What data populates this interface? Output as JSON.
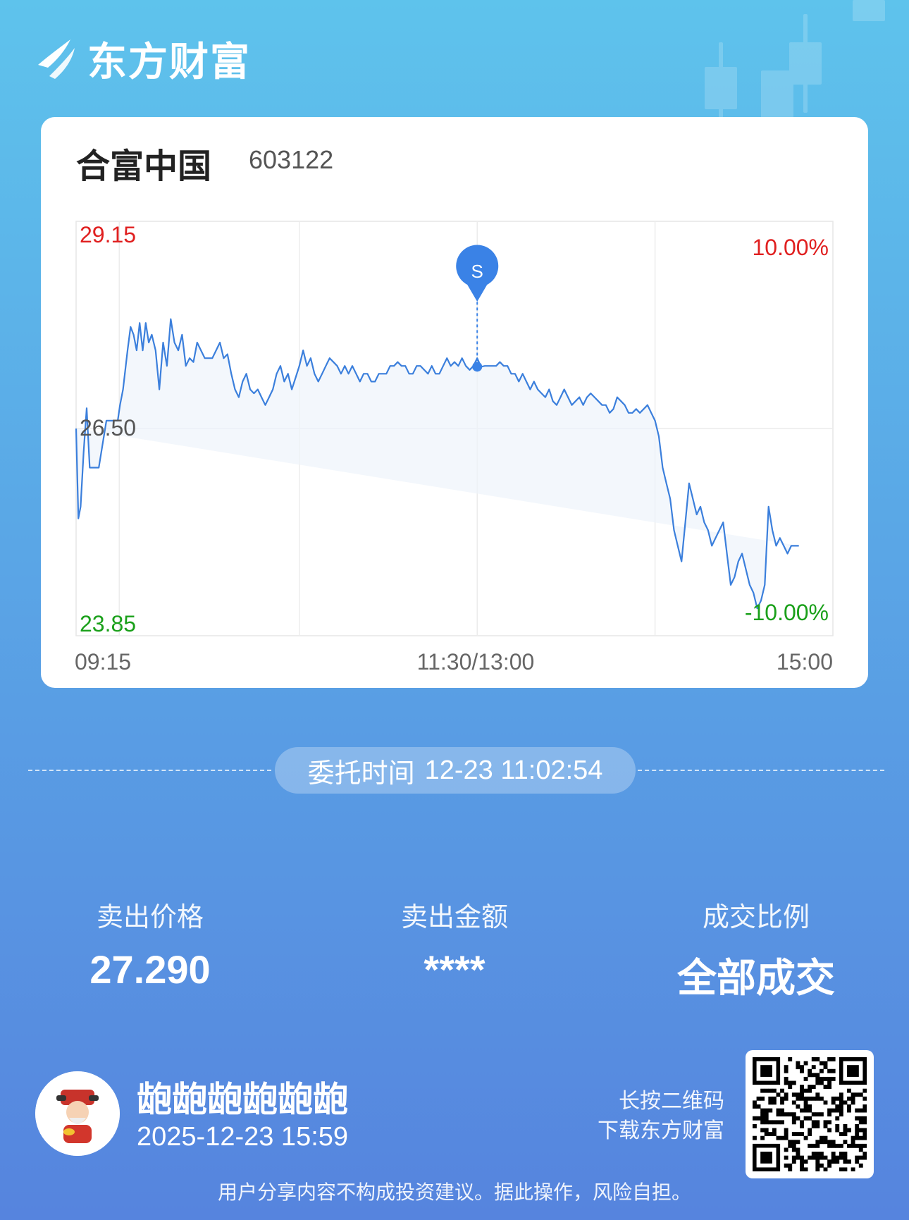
{
  "brand": {
    "name": "东方财富",
    "logo_icon": "eastmoney-logo-icon"
  },
  "stock": {
    "name": "合富中国",
    "code": "603122"
  },
  "chart_data": {
    "type": "line",
    "price_high": "29.15",
    "price_mid": "26.50",
    "price_low": "23.85",
    "pct_high": "10.00%",
    "pct_low": "-10.00%",
    "time_start": "09:15",
    "time_mid": "11:30/13:00",
    "time_end": "15:00",
    "ylim": [
      23.85,
      29.15
    ],
    "prev_close": 26.5,
    "trade_marker": {
      "label": "S",
      "t": 0.53,
      "price": 27.29
    },
    "colors": {
      "line": "#3b7fdc",
      "up": "#e02020",
      "down": "#1aa01a",
      "marker": "#3a82e6"
    },
    "x": [
      0,
      0.003,
      0.006,
      0.01,
      0.014,
      0.018,
      0.02,
      0.025,
      0.03,
      0.035,
      0.04,
      0.045,
      0.05,
      0.055,
      0.058,
      0.062,
      0.068,
      0.072,
      0.076,
      0.08,
      0.084,
      0.088,
      0.092,
      0.096,
      0.1,
      0.105,
      0.11,
      0.115,
      0.12,
      0.125,
      0.13,
      0.135,
      0.14,
      0.145,
      0.15,
      0.155,
      0.16,
      0.165,
      0.17,
      0.175,
      0.18,
      0.185,
      0.19,
      0.195,
      0.2,
      0.205,
      0.21,
      0.215,
      0.22,
      0.225,
      0.23,
      0.235,
      0.24,
      0.245,
      0.25,
      0.255,
      0.26,
      0.265,
      0.27,
      0.275,
      0.28,
      0.285,
      0.29,
      0.295,
      0.3,
      0.305,
      0.31,
      0.315,
      0.32,
      0.325,
      0.33,
      0.335,
      0.34,
      0.345,
      0.35,
      0.355,
      0.36,
      0.365,
      0.37,
      0.375,
      0.38,
      0.385,
      0.39,
      0.395,
      0.4,
      0.405,
      0.41,
      0.415,
      0.42,
      0.425,
      0.43,
      0.435,
      0.44,
      0.445,
      0.45,
      0.455,
      0.46,
      0.465,
      0.47,
      0.475,
      0.48,
      0.485,
      0.49,
      0.495,
      0.5,
      0.505,
      0.51,
      0.515,
      0.52,
      0.525,
      0.53,
      0.535,
      0.54,
      0.545,
      0.55,
      0.555,
      0.56,
      0.565,
      0.57,
      0.575,
      0.58,
      0.585,
      0.59,
      0.595,
      0.6,
      0.605,
      0.61,
      0.615,
      0.62,
      0.625,
      0.63,
      0.635,
      0.64,
      0.645,
      0.65,
      0.655,
      0.66,
      0.665,
      0.67,
      0.675,
      0.68,
      0.685,
      0.69,
      0.695,
      0.7,
      0.705,
      0.71,
      0.715,
      0.72,
      0.725,
      0.73,
      0.735,
      0.74,
      0.745,
      0.75,
      0.755,
      0.76,
      0.765,
      0.77,
      0.775,
      0.78,
      0.785,
      0.79,
      0.795,
      0.8,
      0.805,
      0.81,
      0.815,
      0.82,
      0.825,
      0.83,
      0.835,
      0.84,
      0.845,
      0.85,
      0.855,
      0.86,
      0.865,
      0.87,
      0.875,
      0.88,
      0.885,
      0.89,
      0.895,
      0.9,
      0.905,
      0.91,
      0.915,
      0.92,
      0.925,
      0.93,
      0.935,
      0.94,
      0.945,
      0.95,
      0.955,
      0.96,
      0.965,
      0.97,
      0.975,
      0.98,
      0.985,
      0.99,
      0.995,
      1.0
    ],
    "values": [
      26.5,
      25.35,
      25.5,
      26.2,
      26.76,
      26.0,
      26.0,
      26.0,
      26.0,
      26.3,
      26.6,
      26.6,
      26.6,
      26.6,
      26.8,
      27.0,
      27.5,
      27.8,
      27.7,
      27.5,
      27.85,
      27.5,
      27.85,
      27.6,
      27.7,
      27.5,
      27.0,
      27.6,
      27.3,
      27.9,
      27.6,
      27.5,
      27.7,
      27.3,
      27.4,
      27.35,
      27.6,
      27.5,
      27.4,
      27.4,
      27.4,
      27.5,
      27.6,
      27.4,
      27.45,
      27.2,
      27.0,
      26.9,
      27.1,
      27.2,
      27.0,
      26.95,
      27.0,
      26.9,
      26.8,
      26.9,
      27.0,
      27.2,
      27.3,
      27.1,
      27.2,
      27.0,
      27.15,
      27.3,
      27.5,
      27.3,
      27.4,
      27.2,
      27.1,
      27.2,
      27.3,
      27.4,
      27.35,
      27.3,
      27.2,
      27.3,
      27.2,
      27.3,
      27.2,
      27.1,
      27.2,
      27.2,
      27.1,
      27.1,
      27.2,
      27.2,
      27.2,
      27.3,
      27.3,
      27.35,
      27.3,
      27.3,
      27.2,
      27.2,
      27.3,
      27.3,
      27.25,
      27.2,
      27.3,
      27.2,
      27.2,
      27.3,
      27.4,
      27.3,
      27.35,
      27.3,
      27.4,
      27.3,
      27.25,
      27.3,
      27.4,
      27.29,
      27.3,
      27.3,
      27.3,
      27.3,
      27.35,
      27.3,
      27.3,
      27.2,
      27.2,
      27.1,
      27.2,
      27.1,
      27.0,
      27.1,
      27.0,
      26.95,
      26.9,
      27.0,
      26.85,
      26.8,
      26.9,
      27.0,
      26.9,
      26.8,
      26.85,
      26.9,
      26.8,
      26.9,
      26.95,
      26.9,
      26.85,
      26.8,
      26.8,
      26.7,
      26.75,
      26.9,
      26.85,
      26.8,
      26.7,
      26.7,
      26.75,
      26.7,
      26.75,
      26.8,
      26.7,
      26.6,
      26.4,
      26.0,
      25.8,
      25.6,
      25.2,
      25.0,
      24.8,
      25.3,
      25.8,
      25.6,
      25.4,
      25.5,
      25.3,
      25.2,
      25.0,
      25.1,
      25.2,
      25.3,
      24.9,
      24.5,
      24.6,
      24.8,
      24.9,
      24.7,
      24.5,
      24.4,
      24.2,
      24.3,
      24.5,
      25.5,
      25.2,
      25.0,
      25.1,
      25.0,
      24.9,
      25.0,
      25.0,
      25.0
    ],
    "series": [
      {
        "values": "values"
      }
    ]
  },
  "commission": {
    "label": "委托时间",
    "value": "12-23 11:02:54"
  },
  "stats": [
    {
      "label": "卖出价格",
      "value": "27.290"
    },
    {
      "label": "卖出金额",
      "value": "****"
    },
    {
      "label": "成交比例",
      "value": "全部成交"
    }
  ],
  "user": {
    "name": "龅龅龅龅龅龅",
    "time": "2025-12-23 15:59",
    "avatar_icon": "god-of-wealth-avatar-icon"
  },
  "qr": {
    "hint_line1": "长按二维码",
    "hint_line2": "下载东方财富",
    "icon": "qr-code-icon"
  },
  "disclaimer": "用户分享内容不构成投资建议。据此操作，风险自担。"
}
